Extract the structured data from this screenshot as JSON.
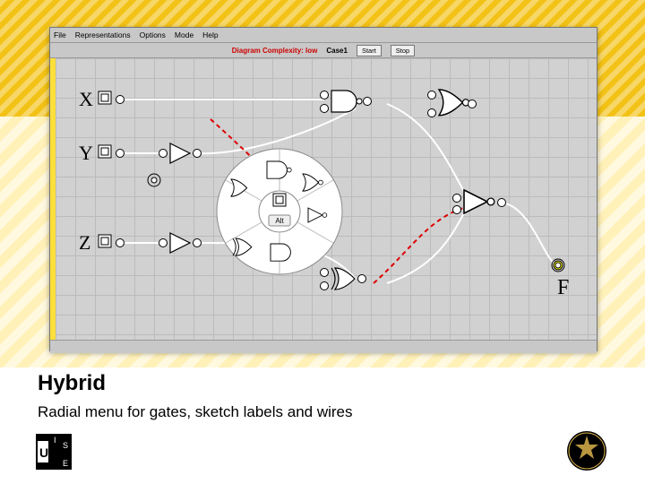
{
  "menu": [
    "File",
    "Representations",
    "Options",
    "Mode",
    "Help"
  ],
  "toolbar": {
    "complexity_label": "Diagram Complexity: low",
    "case_label": "Case1",
    "start_btn": "Start",
    "stop_btn": "Stop"
  },
  "inputs": [
    "X",
    "Y",
    "Z"
  ],
  "output": "F",
  "radial": {
    "center": "Alt",
    "segments": 6
  },
  "slide": {
    "title": "Hybrid",
    "subtitle": "Radial menu for gates, sketch labels and wires"
  },
  "logos": {
    "left": "ISUE",
    "right": "UCF"
  }
}
